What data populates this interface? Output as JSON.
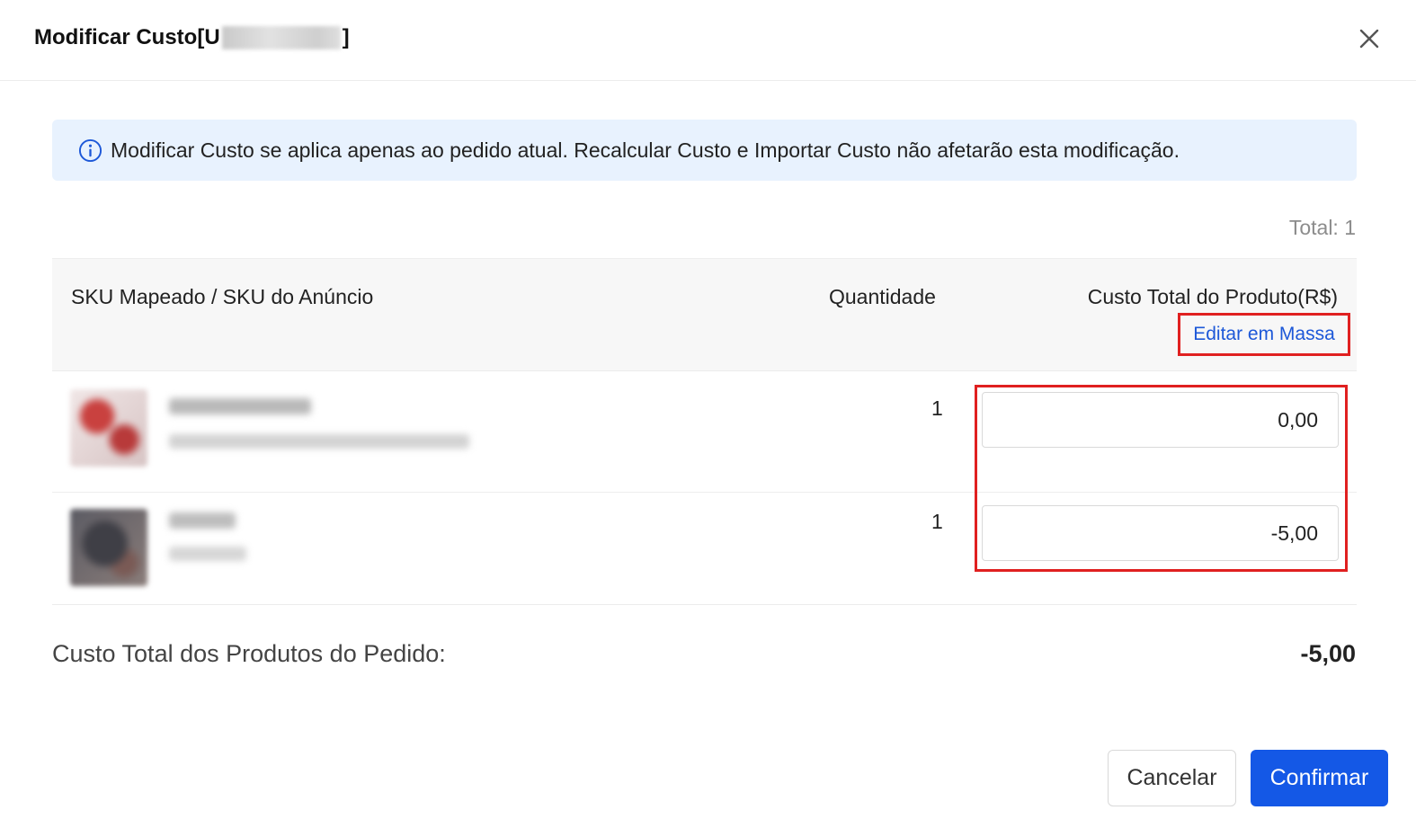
{
  "dialog": {
    "title_prefix": "Modificar Custo[U",
    "title_suffix": "]",
    "close_icon": "close-icon"
  },
  "notice": {
    "icon": "info-icon",
    "text": "Modificar Custo se aplica apenas ao pedido atual. Recalcular Custo e Importar Custo não afetarão esta modificação."
  },
  "table": {
    "total_label": "Total: 1",
    "headers": {
      "sku": "SKU Mapeado / SKU do Anúncio",
      "quantity": "Quantidade",
      "cost": "Custo Total do Produto(R$)"
    },
    "bulk_edit_label": "Editar em Massa",
    "rows": [
      {
        "quantity": "1",
        "cost": "0,00"
      },
      {
        "quantity": "1",
        "cost": "-5,00"
      }
    ]
  },
  "summary": {
    "label": "Custo Total dos Produtos do Pedido:",
    "value": "-5,00"
  },
  "footer": {
    "cancel_label": "Cancelar",
    "confirm_label": "Confirmar"
  },
  "colors": {
    "primary": "#1458e6",
    "link": "#1d58d8",
    "notice_bg": "#e8f2fe",
    "highlight": "#e02020"
  }
}
